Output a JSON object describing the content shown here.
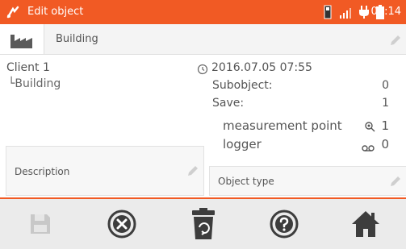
{
  "status_bar": {
    "title": "Edit object",
    "time": "09:14",
    "accent": "#f15a24"
  },
  "object": {
    "name": "Building",
    "icon": "factory-icon"
  },
  "details": {
    "client": "Client 1",
    "subobject_path": "└Building",
    "datetime": "2016.07.05 07:55",
    "subobject_label": "Subobject:",
    "subobject_value": "0",
    "save_label": "Save:",
    "save_value": "1",
    "measurement_point_label": "measurement point",
    "measurement_point_value": "1",
    "logger_label": "logger",
    "logger_value": "0"
  },
  "fields": {
    "description_label": "Description",
    "object_type_label": "Object type"
  },
  "toolbar": {
    "buttons": [
      "save-icon",
      "cancel-icon",
      "delete-icon",
      "help-icon",
      "home-icon"
    ]
  }
}
